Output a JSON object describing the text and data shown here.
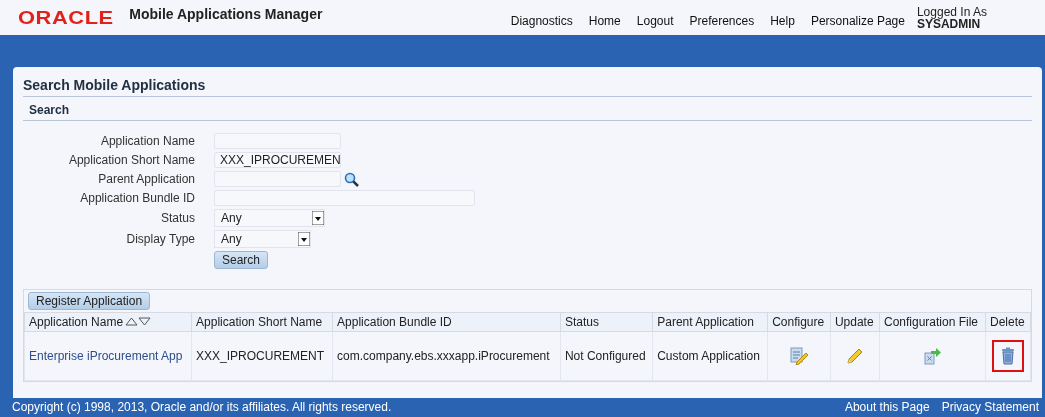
{
  "header": {
    "logo": "ORACLE",
    "title": "Mobile Applications Manager",
    "links": [
      "Diagnostics",
      "Home",
      "Logout",
      "Preferences",
      "Help",
      "Personalize Page"
    ],
    "login_label": "Logged In As",
    "login_user": "SYSADMIN"
  },
  "page_title": "Search Mobile Applications",
  "search": {
    "title": "Search",
    "fields": [
      {
        "label": "Application Name",
        "kind": "text"
      },
      {
        "label": "Application Short Name",
        "kind": "text",
        "value": "XXX_IPROCUREMEN"
      },
      {
        "label": "Parent Application",
        "kind": "lov"
      },
      {
        "label": "Application Bundle ID",
        "kind": "text"
      },
      {
        "label": "Status",
        "kind": "select",
        "value": "Any"
      },
      {
        "label": "Display Type",
        "kind": "select",
        "value": "Any"
      }
    ],
    "button": "Search"
  },
  "register_button": "Register Application",
  "table": {
    "columns": [
      "Application Name",
      "Application Short Name",
      "Application Bundle ID",
      "Status",
      "Parent Application",
      "Configure",
      "Update",
      "Configuration File",
      "Delete"
    ],
    "rows": [
      {
        "cells": [
          "Enterprise iProcurement App",
          "XXX_IPROCUREMENT",
          "com.company.ebs.xxxapp.iProcurement",
          "Not Configured",
          "Custom Application"
        ],
        "delete_highlighted": true
      }
    ]
  },
  "footer": {
    "copyright": "Copyright (c) 1998, 2013, Oracle and/or its affiliates. All rights reserved.",
    "links": [
      "About this Page",
      "Privacy Statement"
    ]
  }
}
